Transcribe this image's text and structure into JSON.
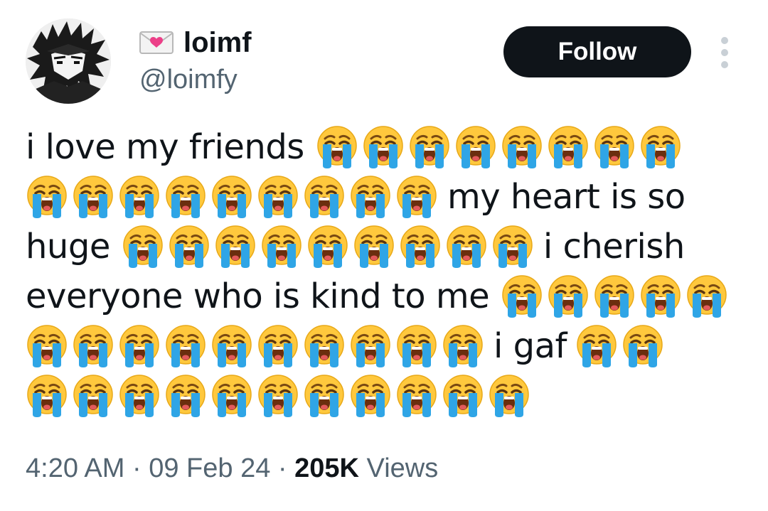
{
  "author": {
    "display_name": "loimf",
    "handle": "@loimfy",
    "name_icon": "love-letter-icon",
    "avatar_icon": "avatar-image"
  },
  "actions": {
    "follow_label": "Follow",
    "more_icon": "more-vertical-icon"
  },
  "tweet": {
    "emoji_icon": "loudly-crying-face-icon",
    "emoji_char": "😭",
    "lines": [
      {
        "before": "i love my friends",
        "emoji_count": 8,
        "after": ""
      },
      {
        "before": "",
        "emoji_count": 9,
        "after": "my heart is so"
      },
      {
        "before": "huge",
        "emoji_count": 9,
        "after": "i cherish"
      },
      {
        "before": "everyone who is kind to me",
        "emoji_count": 5,
        "after": ""
      },
      {
        "before": "",
        "emoji_count": 10,
        "after": "i gaf",
        "trailing_emoji_count": 2
      },
      {
        "before": "",
        "emoji_count": 11,
        "after": ""
      }
    ]
  },
  "meta": {
    "time": "4:20 AM",
    "separator": "·",
    "date": "09 Feb 24",
    "views_count": "205K",
    "views_label": "Views"
  },
  "colors": {
    "text": "#0f1419",
    "secondary": "#536471",
    "follow_bg": "#0f1419",
    "follow_text": "#ffffff",
    "emoji_face": "#ffc83d",
    "emoji_tears": "#2fa5e6"
  }
}
